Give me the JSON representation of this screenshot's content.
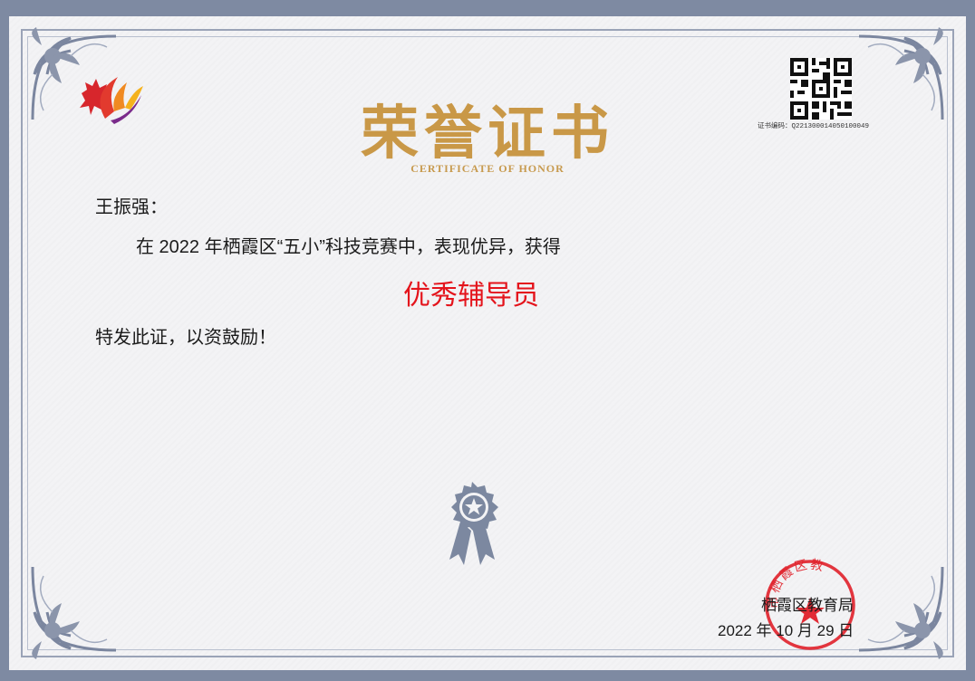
{
  "certificate": {
    "title": "荣誉证书",
    "subtitle": "CERTIFICATE OF HONOR",
    "cert_number_label": "证书编码：Q221300014050100049",
    "recipient_line": "王振强：",
    "body_line": "在 2022 年栖霞区“五小”科技竞赛中，表现优异，获得",
    "award": "优秀辅导员",
    "closing": "特发此证，以资鼓励！",
    "issuer": "栖霞区教育局",
    "date": "2022 年 10 月 29 日",
    "seal_text": "市栖霞区教"
  },
  "colors": {
    "title_gold": "#c99847",
    "award_red": "#e4141c",
    "border_gray": "#7e8aa2",
    "seal_red": "#e0202a"
  },
  "icons": {
    "logo": "maple-leaf-logo-icon",
    "qr": "qr-code-icon",
    "medal": "award-medal-icon",
    "seal": "official-seal-icon"
  }
}
